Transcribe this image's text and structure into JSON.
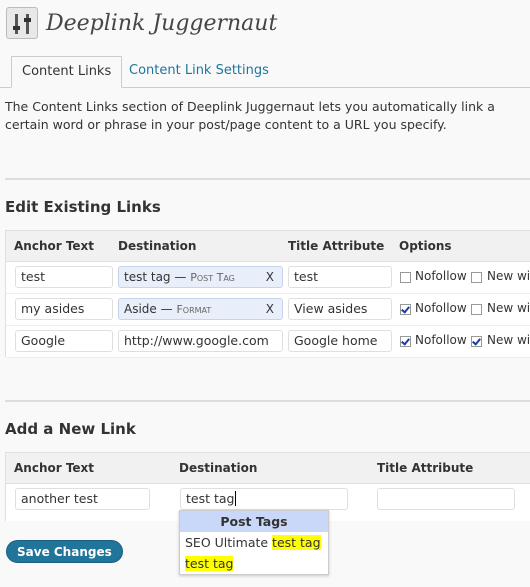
{
  "header": {
    "title": "Deeplink Juggernaut",
    "icon": "sliders-icon"
  },
  "tabs": [
    {
      "label": "Content Links",
      "active": true
    },
    {
      "label": "Content Link Settings",
      "active": false
    }
  ],
  "intro": "The Content Links section of Deeplink Juggernaut lets you automatically link a certain word or phrase in your post/page content to a URL you specify.",
  "edit_section": {
    "title": "Edit Existing Links",
    "columns": [
      "Anchor Text",
      "Destination",
      "Title Attribute",
      "Options"
    ],
    "rows": [
      {
        "anchor": "test",
        "destination": {
          "kind": "token",
          "label": "test tag",
          "type": "Post Tag",
          "remove": "X"
        },
        "title_attr": "test",
        "nofollow": false,
        "nofollow_label": "Nofollow",
        "newwin": false,
        "newwin_label": "New win"
      },
      {
        "anchor": "my asides",
        "destination": {
          "kind": "token",
          "label": "Aside",
          "type": "Format",
          "remove": "X"
        },
        "title_attr": "View asides",
        "nofollow": true,
        "nofollow_label": "Nofollow",
        "newwin": false,
        "newwin_label": "New win"
      },
      {
        "anchor": "Google",
        "destination": {
          "kind": "text",
          "value": "http://www.google.com"
        },
        "title_attr": "Google home",
        "nofollow": true,
        "nofollow_label": "Nofollow",
        "newwin": true,
        "newwin_label": "New win"
      }
    ],
    "separator": "—"
  },
  "add_section": {
    "title": "Add a New Link",
    "columns": [
      "Anchor Text",
      "Destination",
      "Title Attribute"
    ],
    "anchor_value": "another test",
    "destination_value": "test tag",
    "title_value": "",
    "suggestions": {
      "header": "Post Tags",
      "items": [
        {
          "prefix": "SEO Ultimate ",
          "match": "test tag"
        },
        {
          "prefix": "",
          "match": "test tag"
        }
      ]
    }
  },
  "save_label": "Save Changes",
  "colors": {
    "link_blue": "#21759b",
    "token_bg": "#e8eefa",
    "dropdown_header": "#c9d7f8",
    "highlight": "#ffff00"
  }
}
